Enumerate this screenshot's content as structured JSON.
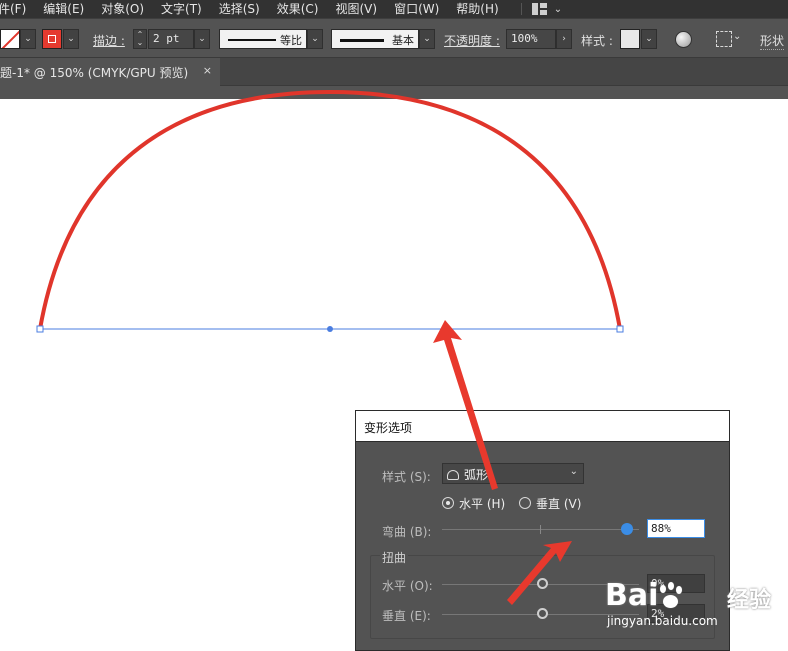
{
  "menu": {
    "items": [
      "件(F)",
      "编辑(E)",
      "对象(O)",
      "文字(T)",
      "选择(S)",
      "效果(C)",
      "视图(V)",
      "窗口(W)",
      "帮助(H)"
    ]
  },
  "control_bar": {
    "stroke_label": "描边 :",
    "stroke_weight": "2 pt",
    "profile_label": "等比",
    "brush_label": "基本",
    "opacity_label": "不透明度 :",
    "opacity_value": "100%",
    "style_label": "样式 :",
    "shape_label": "形状",
    "fill_color": "#ffffff",
    "stroke_color": "#e53a2f"
  },
  "document_tab": {
    "title": "题-1* @ 150% (CMYK/GPU 预览)",
    "close": "×"
  },
  "artwork": {
    "arc_color": "#e0352b",
    "path_color": "#4a7de0",
    "arrow_color": "#e8392d"
  },
  "warp_dialog": {
    "title": "变形选项",
    "style_label": "样式 (S):",
    "style_value": "弧形",
    "horizontal_label": "水平 (H)",
    "vertical_label": "垂直 (V)",
    "orientation_selected": "horizontal",
    "bend_label": "弯曲 (B):",
    "bend_value": "88%",
    "bend_fraction": 0.94,
    "distortion_label": "扭曲",
    "distort_h_label": "水平 (O):",
    "distort_h_value": "0%",
    "distort_v_label": "垂直 (E):",
    "distort_v_value": "2%"
  },
  "watermark": {
    "brand": "Bai",
    "brand_tail": "经验",
    "url": "jingyan.baidu.com"
  }
}
